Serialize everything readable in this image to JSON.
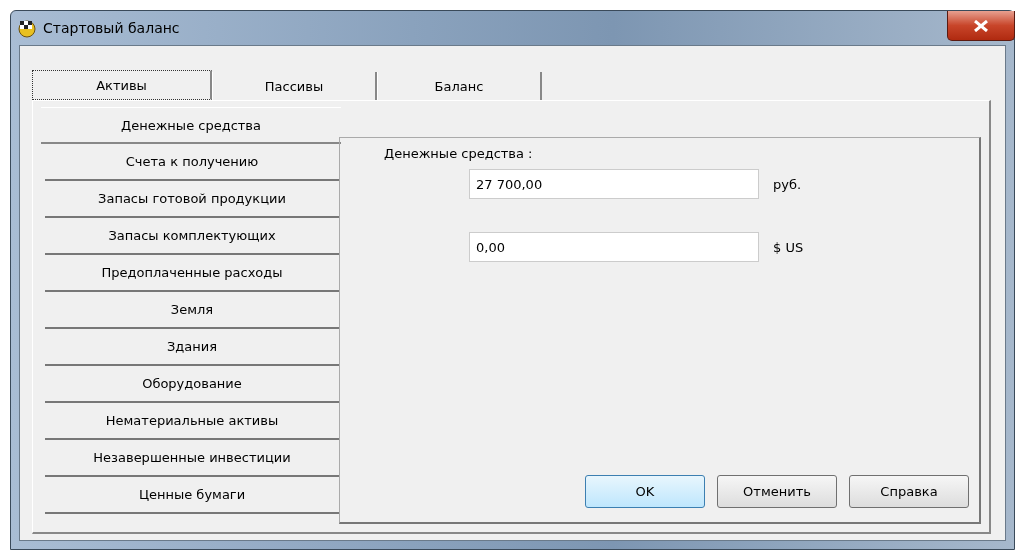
{
  "window": {
    "title": "Стартовый баланс"
  },
  "tabs": [
    {
      "label": "Активы",
      "selected": true
    },
    {
      "label": "Пассивы",
      "selected": false
    },
    {
      "label": "Баланс",
      "selected": false
    }
  ],
  "sidebar": {
    "items": [
      {
        "label": "Денежные средства",
        "selected": true
      },
      {
        "label": "Счета к получению",
        "selected": false
      },
      {
        "label": "Запасы готовой продукции",
        "selected": false
      },
      {
        "label": "Запасы комплектующих",
        "selected": false
      },
      {
        "label": "Предоплаченные расходы",
        "selected": false
      },
      {
        "label": "Земля",
        "selected": false
      },
      {
        "label": "Здания",
        "selected": false
      },
      {
        "label": "Оборудование",
        "selected": false
      },
      {
        "label": "Нематериальные активы",
        "selected": false
      },
      {
        "label": "Незавершенные инвестиции",
        "selected": false
      },
      {
        "label": "Ценные бумаги",
        "selected": false
      }
    ]
  },
  "panel": {
    "heading": "Денежные средства :",
    "fields": [
      {
        "value": "27 700,00",
        "unit": "руб."
      },
      {
        "value": "0,00",
        "unit": "$ US"
      }
    ]
  },
  "buttons": [
    {
      "label": "OK",
      "default": true
    },
    {
      "label": "Отменить",
      "default": false
    },
    {
      "label": "Справка",
      "default": false
    }
  ]
}
